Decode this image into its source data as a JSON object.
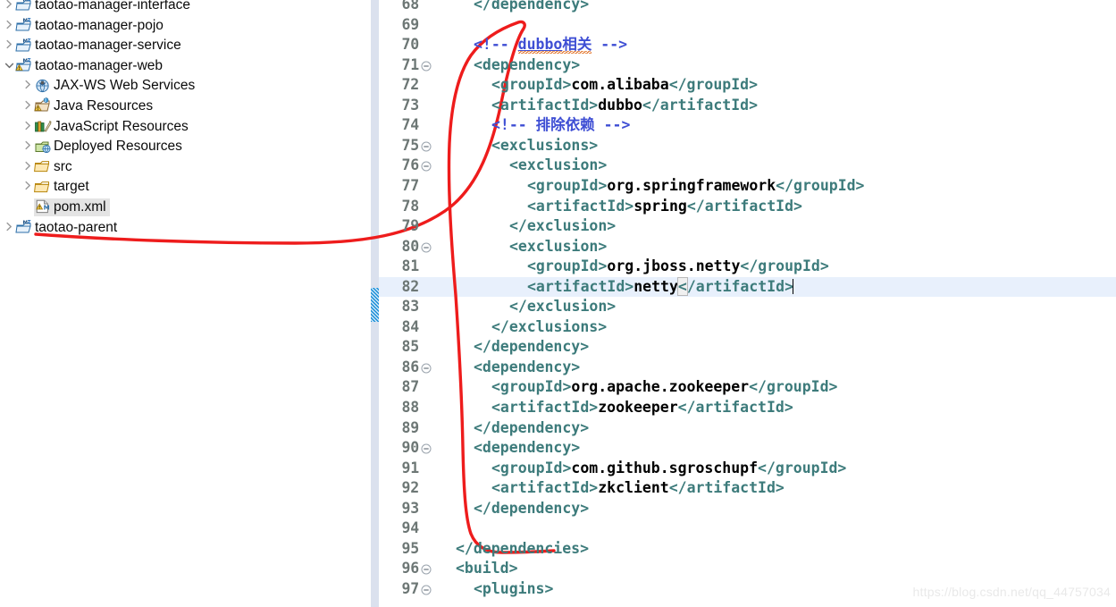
{
  "explorer": {
    "name": "package-explorer",
    "items": [
      {
        "label": "taotao-manager-interface",
        "icon": "maven-project-icon",
        "twisty": "collapsed",
        "indent": 0,
        "selected": false
      },
      {
        "label": "taotao-manager-pojo",
        "icon": "maven-project-icon",
        "twisty": "collapsed",
        "indent": 0,
        "selected": false
      },
      {
        "label": "taotao-manager-service",
        "icon": "maven-project-icon",
        "twisty": "collapsed",
        "indent": 0,
        "selected": false
      },
      {
        "label": "taotao-manager-web",
        "icon": "maven-project-warning-icon",
        "twisty": "expanded",
        "indent": 0,
        "selected": false
      },
      {
        "label": "JAX-WS Web Services",
        "icon": "jaxws-icon",
        "twisty": "collapsed",
        "indent": 1,
        "selected": false
      },
      {
        "label": "Java Resources",
        "icon": "java-resources-icon",
        "twisty": "collapsed",
        "indent": 1,
        "selected": false
      },
      {
        "label": "JavaScript Resources",
        "icon": "javascript-resources-icon",
        "twisty": "collapsed",
        "indent": 1,
        "selected": false
      },
      {
        "label": "Deployed Resources",
        "icon": "deployed-resources-icon",
        "twisty": "collapsed",
        "indent": 1,
        "selected": false
      },
      {
        "label": "src",
        "icon": "folder-icon",
        "twisty": "collapsed",
        "indent": 1,
        "selected": false
      },
      {
        "label": "target",
        "icon": "folder-icon",
        "twisty": "collapsed",
        "indent": 1,
        "selected": false
      },
      {
        "label": "pom.xml",
        "icon": "pom-xml-warning-icon",
        "twisty": "none",
        "indent": 1,
        "selected": true
      },
      {
        "label": "taotao-parent",
        "icon": "maven-project-icon",
        "twisty": "collapsed",
        "indent": 0,
        "selected": false
      }
    ]
  },
  "editor": {
    "name": "pom-xml-editor",
    "current_line": 82,
    "lines": [
      {
        "n": 68,
        "fold": false,
        "indent": 4,
        "segs": [
          {
            "t": "tag",
            "v": "</dependency>"
          }
        ]
      },
      {
        "n": 69,
        "fold": false,
        "indent": 0,
        "segs": []
      },
      {
        "n": 70,
        "fold": false,
        "indent": 4,
        "segs": [
          {
            "t": "cmt-dubbo",
            "v": "<!-- dubbo相关 -->"
          }
        ]
      },
      {
        "n": 71,
        "fold": true,
        "indent": 4,
        "segs": [
          {
            "t": "tag",
            "v": "<dependency>"
          }
        ]
      },
      {
        "n": 72,
        "fold": false,
        "indent": 6,
        "segs": [
          {
            "t": "tag",
            "v": "<groupId>"
          },
          {
            "t": "txt",
            "v": "com.alibaba"
          },
          {
            "t": "tag",
            "v": "</groupId>"
          }
        ]
      },
      {
        "n": 73,
        "fold": false,
        "indent": 6,
        "segs": [
          {
            "t": "tag",
            "v": "<artifactId>"
          },
          {
            "t": "txt",
            "v": "dubbo"
          },
          {
            "t": "tag",
            "v": "</artifactId>"
          }
        ]
      },
      {
        "n": 74,
        "fold": false,
        "indent": 6,
        "segs": [
          {
            "t": "cmt",
            "v": "<!-- 排除依赖 -->"
          }
        ]
      },
      {
        "n": 75,
        "fold": true,
        "indent": 6,
        "segs": [
          {
            "t": "tag",
            "v": "<exclusions>"
          }
        ]
      },
      {
        "n": 76,
        "fold": true,
        "indent": 8,
        "segs": [
          {
            "t": "tag",
            "v": "<exclusion>"
          }
        ]
      },
      {
        "n": 77,
        "fold": false,
        "indent": 10,
        "segs": [
          {
            "t": "tag",
            "v": "<groupId>"
          },
          {
            "t": "txt",
            "v": "org.springframework"
          },
          {
            "t": "tag",
            "v": "</groupId>"
          }
        ]
      },
      {
        "n": 78,
        "fold": false,
        "indent": 10,
        "segs": [
          {
            "t": "tag",
            "v": "<artifactId>"
          },
          {
            "t": "txt",
            "v": "spring"
          },
          {
            "t": "tag",
            "v": "</artifactId>"
          }
        ]
      },
      {
        "n": 79,
        "fold": false,
        "indent": 8,
        "segs": [
          {
            "t": "tag",
            "v": "</exclusion>"
          }
        ]
      },
      {
        "n": 80,
        "fold": true,
        "indent": 8,
        "segs": [
          {
            "t": "tag",
            "v": "<exclusion>"
          }
        ]
      },
      {
        "n": 81,
        "fold": false,
        "indent": 10,
        "segs": [
          {
            "t": "tag",
            "v": "<groupId>"
          },
          {
            "t": "txt",
            "v": "org.jboss.netty"
          },
          {
            "t": "tag",
            "v": "</groupId>"
          }
        ]
      },
      {
        "n": 82,
        "fold": false,
        "indent": 10,
        "segs": [
          {
            "t": "tag",
            "v": "<artifactId>"
          },
          {
            "t": "txt",
            "v": "netty"
          },
          {
            "t": "brk",
            "v": "<"
          },
          {
            "t": "tag",
            "v": "/artifactId>"
          },
          {
            "t": "caret",
            "v": ""
          }
        ]
      },
      {
        "n": 83,
        "fold": false,
        "indent": 8,
        "segs": [
          {
            "t": "tag",
            "v": "</exclusion>"
          }
        ]
      },
      {
        "n": 84,
        "fold": false,
        "indent": 6,
        "segs": [
          {
            "t": "tag",
            "v": "</exclusions>"
          }
        ]
      },
      {
        "n": 85,
        "fold": false,
        "indent": 4,
        "segs": [
          {
            "t": "tag",
            "v": "</dependency>"
          }
        ]
      },
      {
        "n": 86,
        "fold": true,
        "indent": 4,
        "segs": [
          {
            "t": "tag",
            "v": "<dependency>"
          }
        ]
      },
      {
        "n": 87,
        "fold": false,
        "indent": 6,
        "segs": [
          {
            "t": "tag",
            "v": "<groupId>"
          },
          {
            "t": "txt",
            "v": "org.apache.zookeeper"
          },
          {
            "t": "tag",
            "v": "</groupId>"
          }
        ]
      },
      {
        "n": 88,
        "fold": false,
        "indent": 6,
        "segs": [
          {
            "t": "tag",
            "v": "<artifactId>"
          },
          {
            "t": "txt",
            "v": "zookeeper"
          },
          {
            "t": "tag",
            "v": "</artifactId>"
          }
        ]
      },
      {
        "n": 89,
        "fold": false,
        "indent": 4,
        "segs": [
          {
            "t": "tag",
            "v": "</dependency>"
          }
        ]
      },
      {
        "n": 90,
        "fold": true,
        "indent": 4,
        "segs": [
          {
            "t": "tag",
            "v": "<dependency>"
          }
        ]
      },
      {
        "n": 91,
        "fold": false,
        "indent": 6,
        "segs": [
          {
            "t": "tag",
            "v": "<groupId>"
          },
          {
            "t": "txt",
            "v": "com.github.sgroschupf"
          },
          {
            "t": "tag",
            "v": "</groupId>"
          }
        ]
      },
      {
        "n": 92,
        "fold": false,
        "indent": 6,
        "segs": [
          {
            "t": "tag",
            "v": "<artifactId>"
          },
          {
            "t": "txt",
            "v": "zkclient"
          },
          {
            "t": "tag",
            "v": "</artifactId>"
          }
        ]
      },
      {
        "n": 93,
        "fold": false,
        "indent": 4,
        "segs": [
          {
            "t": "tag",
            "v": "</dependency>"
          }
        ]
      },
      {
        "n": 94,
        "fold": false,
        "indent": 0,
        "segs": []
      },
      {
        "n": 95,
        "fold": false,
        "indent": 2,
        "segs": [
          {
            "t": "tag",
            "v": "</dependencies>"
          }
        ]
      },
      {
        "n": 96,
        "fold": true,
        "indent": 2,
        "segs": [
          {
            "t": "tag",
            "v": "<build>"
          }
        ]
      },
      {
        "n": 97,
        "fold": true,
        "indent": 4,
        "segs": [
          {
            "t": "tag",
            "v": "<plugins>"
          }
        ]
      }
    ]
  },
  "watermark": {
    "text": "https://blog.csdn.net/qq_44757034"
  },
  "annotation": {
    "name": "red-pen-highlight",
    "color": "#ee1c1c"
  },
  "colors": {
    "tag": "#3d7b7b",
    "text": "#000000",
    "comment": "#3f4fd4",
    "line_number": "#6d7775",
    "current_line_bg": "#e8f0fc",
    "gutter_bg": "#f7f7f7",
    "marker_bar_bg": "#dbe1ee",
    "change_marker": "#1a8fd8",
    "selection_bg": "#e4e4e4",
    "annotation": "#ee1c1c",
    "watermark": "#e9e9e9"
  }
}
